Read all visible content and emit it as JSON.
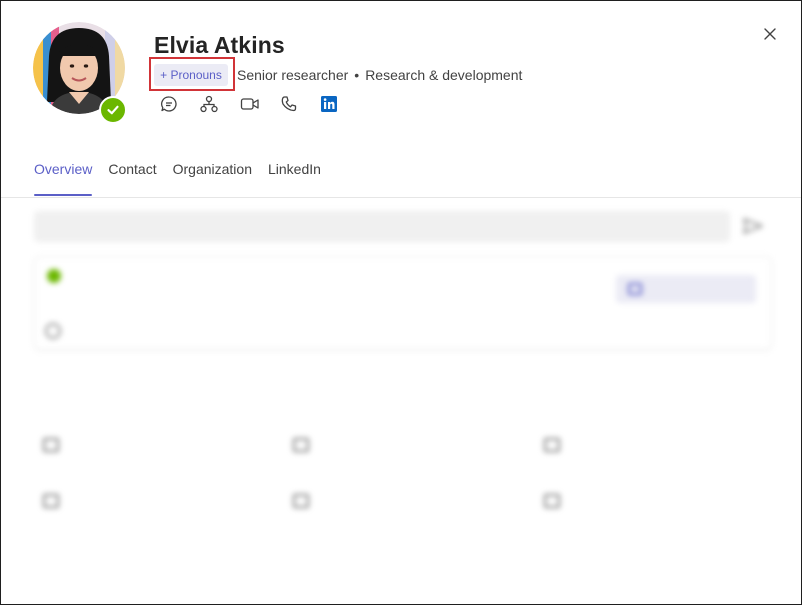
{
  "profile": {
    "name": "Elvia Atkins",
    "pronouns_button": "+ Pronouns",
    "title": "Senior researcher",
    "separator": "•",
    "department": "Research & development",
    "presence": "available"
  },
  "actions": [
    {
      "icon": "chat-icon"
    },
    {
      "icon": "org-chart-icon"
    },
    {
      "icon": "video-call-icon"
    },
    {
      "icon": "phone-call-icon"
    },
    {
      "icon": "linkedin-icon"
    }
  ],
  "tabs": [
    {
      "label": "Overview",
      "active": true
    },
    {
      "label": "Contact",
      "active": false
    },
    {
      "label": "Organization",
      "active": false
    },
    {
      "label": "LinkedIn",
      "active": false
    }
  ],
  "colors": {
    "accent": "#5b5fc7",
    "presence_available": "#6bb700",
    "highlight": "#d13438",
    "linkedin": "#0a66c2"
  }
}
